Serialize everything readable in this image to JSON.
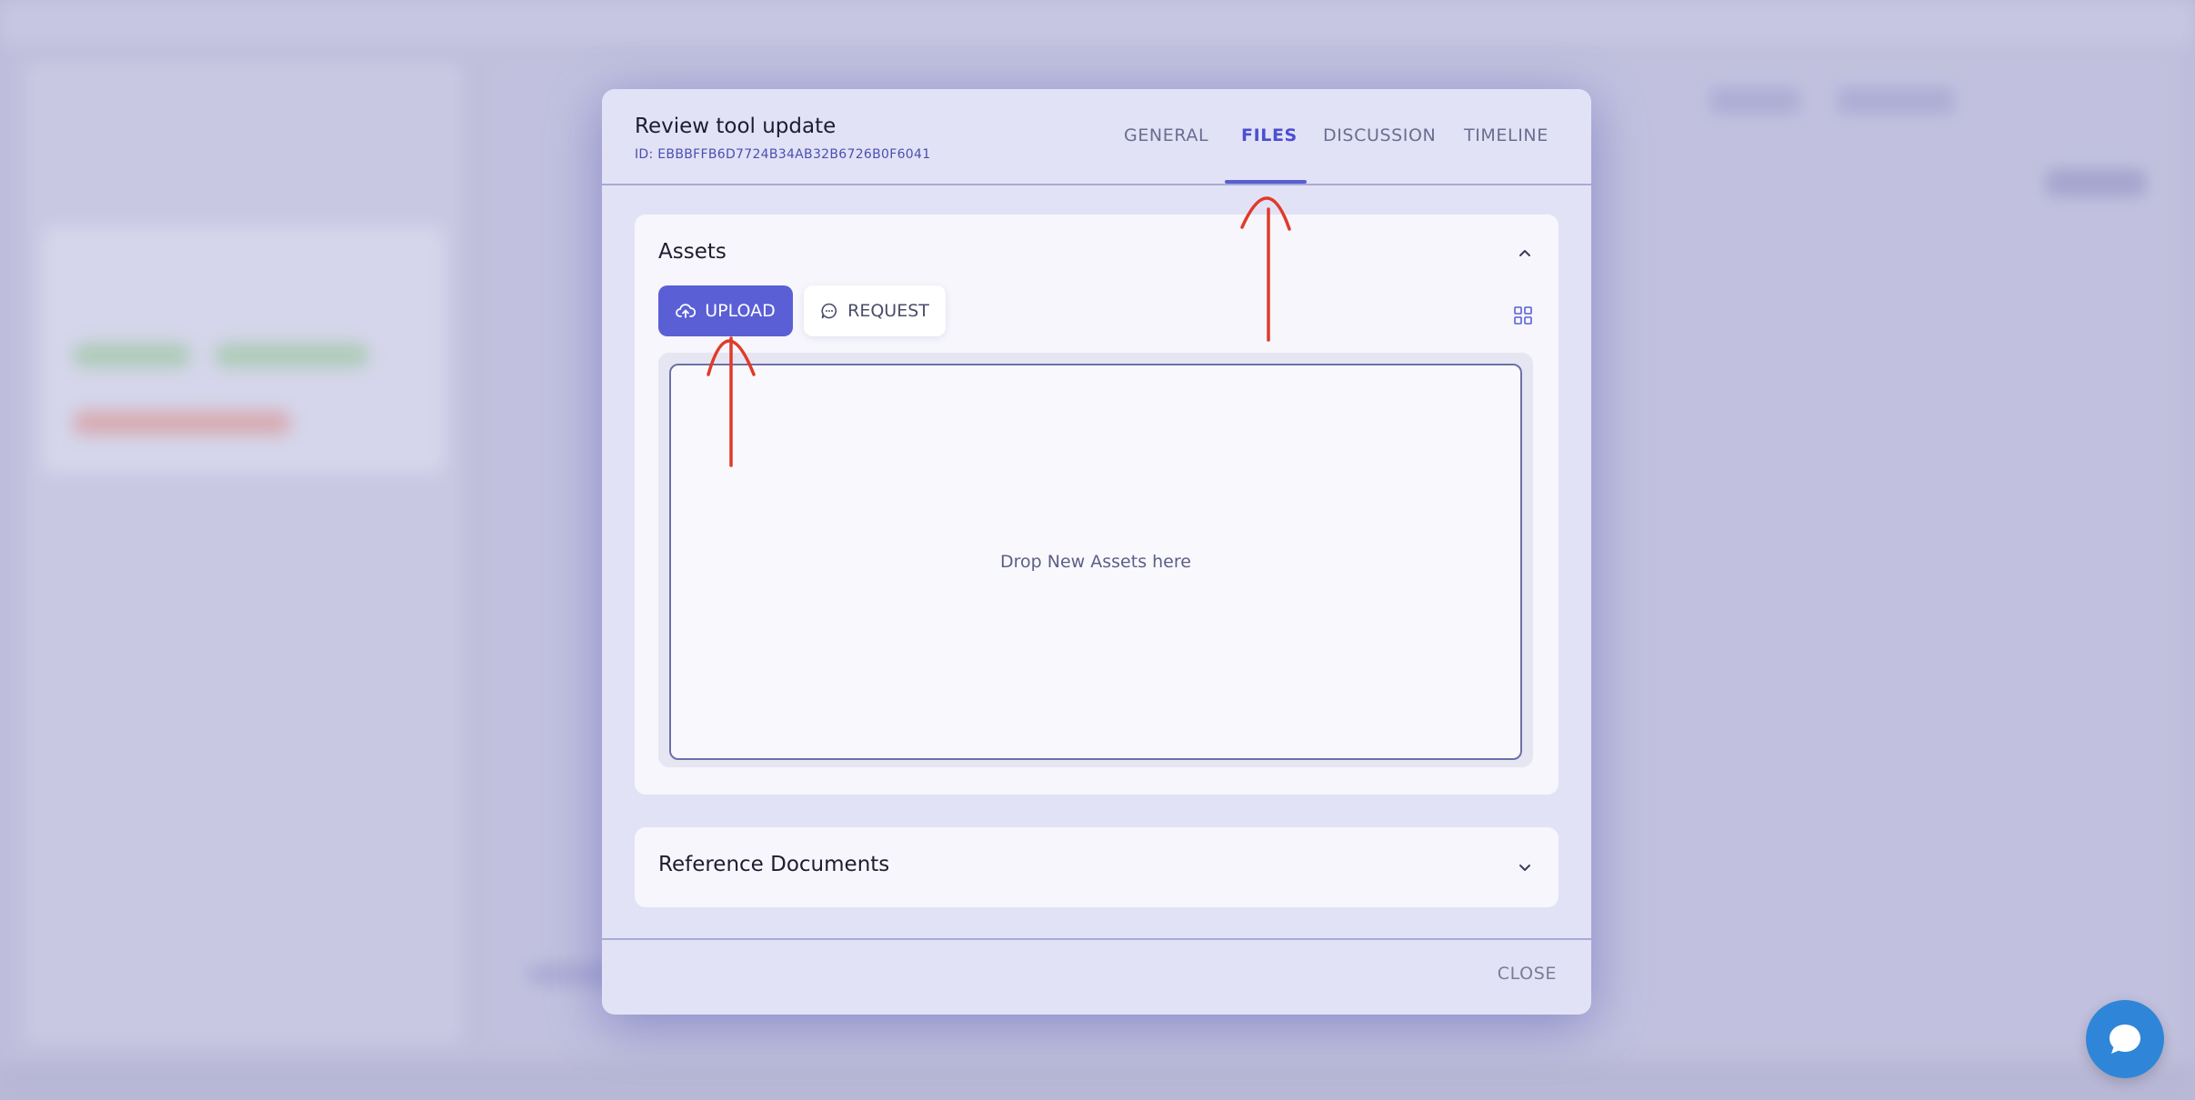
{
  "modal": {
    "title": "Review tool update",
    "id_text": "ID: EBBBFFB6D7724B34AB32B6726B0F6041",
    "tabs": [
      {
        "label": "GENERAL",
        "active": false
      },
      {
        "label": "FILES",
        "active": true
      },
      {
        "label": "DISCUSSION",
        "active": false
      },
      {
        "label": "TIMELINE",
        "active": false
      }
    ],
    "assets": {
      "title": "Assets",
      "upload_label": "UPLOAD",
      "request_label": "REQUEST",
      "drop_text": "Drop New Assets here"
    },
    "reference": {
      "title": "Reference Documents"
    },
    "close_label": "CLOSE"
  },
  "colors": {
    "accent": "#5b5fd6",
    "annotation": "#e03a2a",
    "chat": "#2f86d8"
  },
  "icons": [
    "cloud-upload-icon",
    "chat-bubble-icon",
    "grid-view-icon",
    "chevron-up-icon",
    "chevron-down-icon",
    "chat-widget-icon"
  ]
}
